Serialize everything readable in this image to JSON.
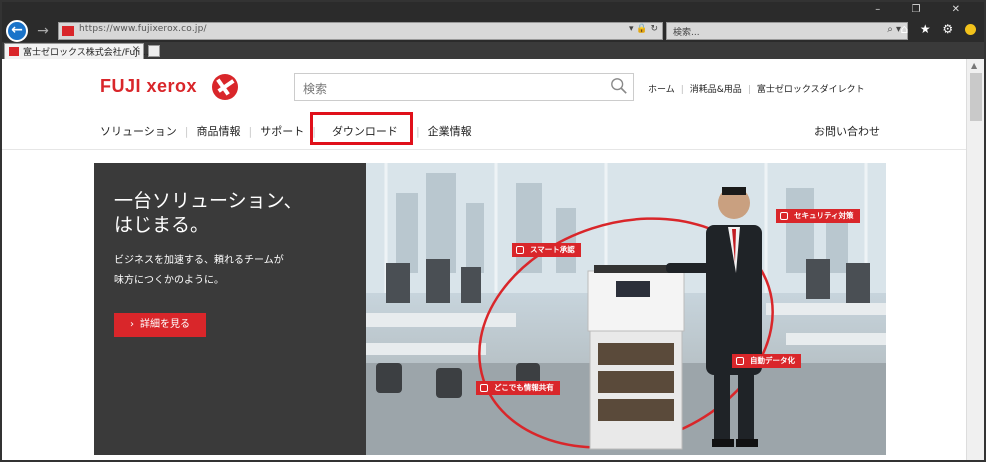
{
  "browser": {
    "url": "https://www.fujixerox.co.jp/",
    "search_placeholder": "検索...",
    "tab_label": "富士ゼロックス株式会社/Fuji ...",
    "tab_close": "×",
    "window_controls": "– ❐ ✕",
    "toolbar_icons": "⌂ ★ ⚙",
    "url_icons": "▾ 🔒 ↻",
    "search_icon": "⌕ ▾"
  },
  "site": {
    "logo_text": "FUJI xerox",
    "search_placeholder": "検索",
    "util_links": [
      "ホーム",
      "消耗品&用品",
      "富士ゼロックスダイレクト"
    ],
    "nav_items": [
      "ソリューション",
      "商品情報",
      "サポート",
      "ダウンロード",
      "企業情報"
    ],
    "contact": "お問い合わせ"
  },
  "hero": {
    "title": "一台ソリューション、\nはじまる。",
    "subtitle": "ビジネスを加速する、頼れるチームが\n味方につくかのように。",
    "cta": "詳細を見る",
    "cta_chevron": "›",
    "callouts": [
      "スマート承認",
      "セキュリティ対策",
      "自動データ化",
      "どこでも情報共有"
    ]
  },
  "colors": {
    "brand": "#d9262a",
    "highlight": "#e0101a"
  }
}
